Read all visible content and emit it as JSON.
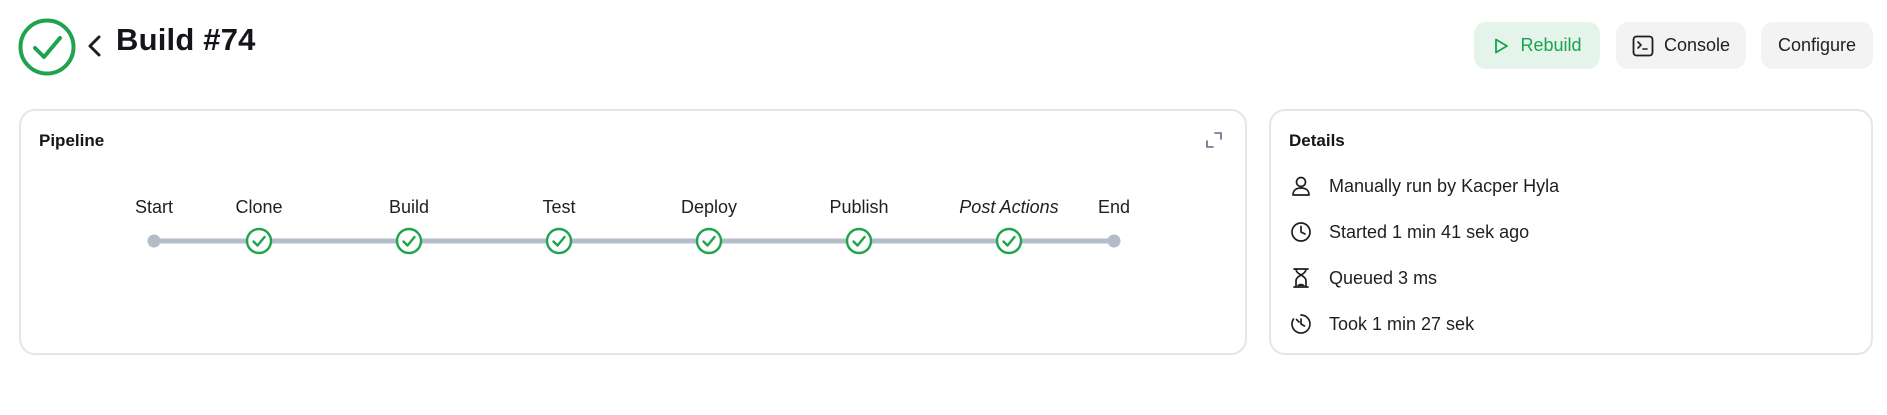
{
  "header": {
    "title": "Build #74",
    "status": "success",
    "status_icon": "check-circle-icon",
    "back_icon": "chevron-left-icon",
    "buttons": {
      "rebuild": "Rebuild",
      "console": "Console",
      "configure": "Configure"
    }
  },
  "pipeline": {
    "title": "Pipeline",
    "expand_icon": "expand-icon",
    "start_label": "Start",
    "end_label": "End",
    "stages": [
      {
        "label": "Clone",
        "status": "success"
      },
      {
        "label": "Build",
        "status": "success"
      },
      {
        "label": "Test",
        "status": "success"
      },
      {
        "label": "Deploy",
        "status": "success"
      },
      {
        "label": "Publish",
        "status": "success"
      },
      {
        "label": "Post Actions",
        "status": "success"
      }
    ]
  },
  "details": {
    "title": "Details",
    "rows": [
      {
        "icon": "user-icon",
        "text": "Manually run by Kacper Hyla"
      },
      {
        "icon": "clock-icon",
        "text": "Started 1 min 41 sek ago"
      },
      {
        "icon": "hourglass-icon",
        "text": "Queued 3 ms"
      },
      {
        "icon": "timer-icon",
        "text": "Took 1 min 27 sek"
      }
    ]
  },
  "colors": {
    "success": "#1fa34d",
    "rebuild_bg": "#e4f4ea",
    "button_bg": "#f3f3f4",
    "track": "#b3bdca",
    "card_border": "#e6e6e9"
  }
}
